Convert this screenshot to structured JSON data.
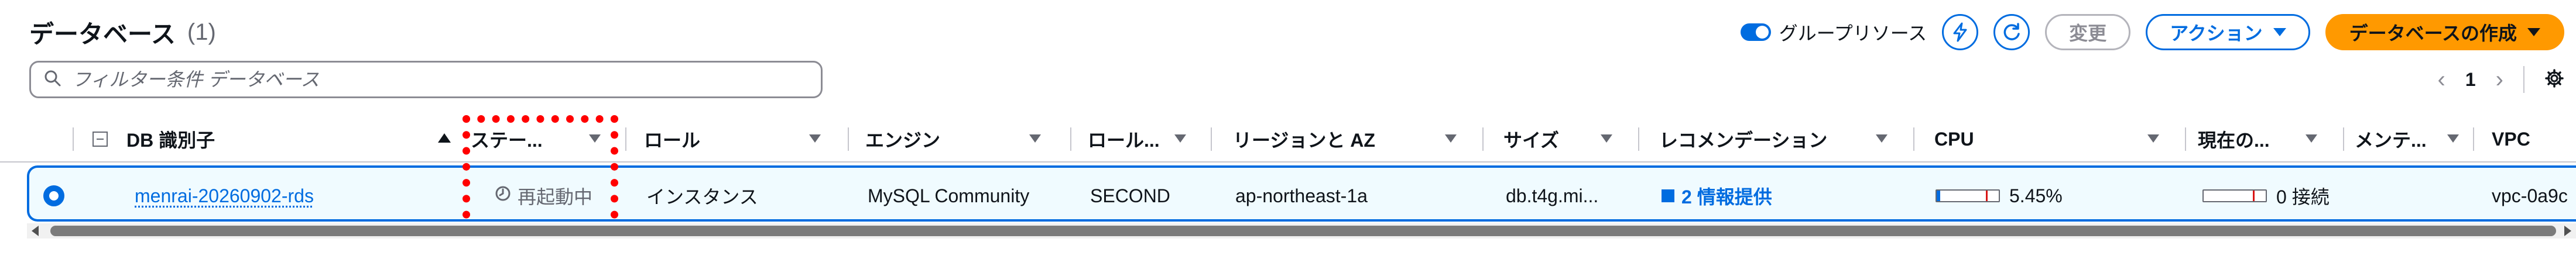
{
  "header": {
    "title": "データベース",
    "count": "(1)"
  },
  "toolbar": {
    "group_resources_label": "グループリソース",
    "group_resources_enabled": true,
    "modify_label": "変更",
    "actions_label": "アクション",
    "create_label": "データベースの作成"
  },
  "search": {
    "placeholder": "フィルター条件 データベース"
  },
  "pagination": {
    "current_page": "1"
  },
  "table": {
    "columns": {
      "db_id": "DB 識別子",
      "status": "ステー...",
      "role": "ロール",
      "engine": "エンジン",
      "role2": "ロール...",
      "region": "リージョンと AZ",
      "size": "サイズ",
      "recommendations": "レコメンデーション",
      "cpu": "CPU",
      "current": "現在の...",
      "maintenance": "メンテ...",
      "vpc": "VPC"
    },
    "rows": [
      {
        "selected": true,
        "db_id": "menrai-20260902-rds",
        "status": "再起動中",
        "role": "インスタンス",
        "engine": "MySQL Community",
        "role2": "SECOND",
        "region": "ap-northeast-1a",
        "size": "db.t4g.mi...",
        "recommendations": "2 情報提供",
        "cpu": "5.45%",
        "cpu_fraction": 0.0545,
        "current": "0 接続",
        "current_fraction": 0.0,
        "maintenance": "",
        "vpc": "vpc-0a9c"
      }
    ]
  },
  "colors": {
    "accent": "#006ce0",
    "primary_button": "#ff9900",
    "highlight_annotation": "#ff0000",
    "selected_row_bg": "#f0fbff"
  }
}
